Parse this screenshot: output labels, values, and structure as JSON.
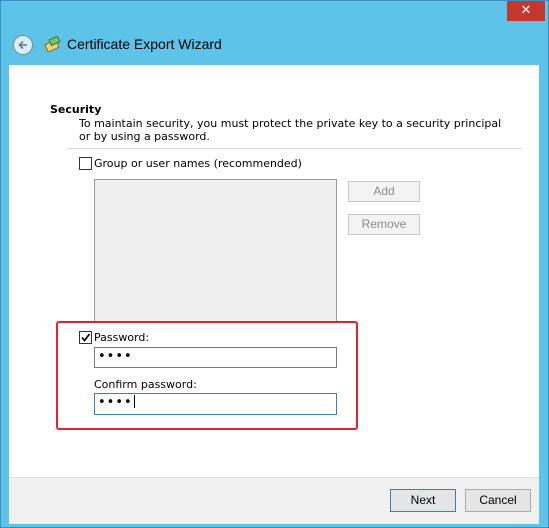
{
  "window": {
    "title": "Certificate Export Wizard",
    "close_glyph": "✕"
  },
  "security": {
    "heading": "Security",
    "description": "To maintain security, you must protect the private key to a security principal or by using a password."
  },
  "group_option": {
    "label": "Group or user names (recommended)",
    "checked": false
  },
  "list_buttons": {
    "add": "Add",
    "remove": "Remove"
  },
  "password_option": {
    "label": "Password:",
    "checked": true,
    "value": "••••"
  },
  "confirm": {
    "label": "Confirm password:",
    "value": "••••"
  },
  "footer": {
    "next": "Next",
    "cancel": "Cancel"
  },
  "colors": {
    "title_bar": "#5ec3e9",
    "close": "#c5372c",
    "highlight": "#e8202a"
  }
}
